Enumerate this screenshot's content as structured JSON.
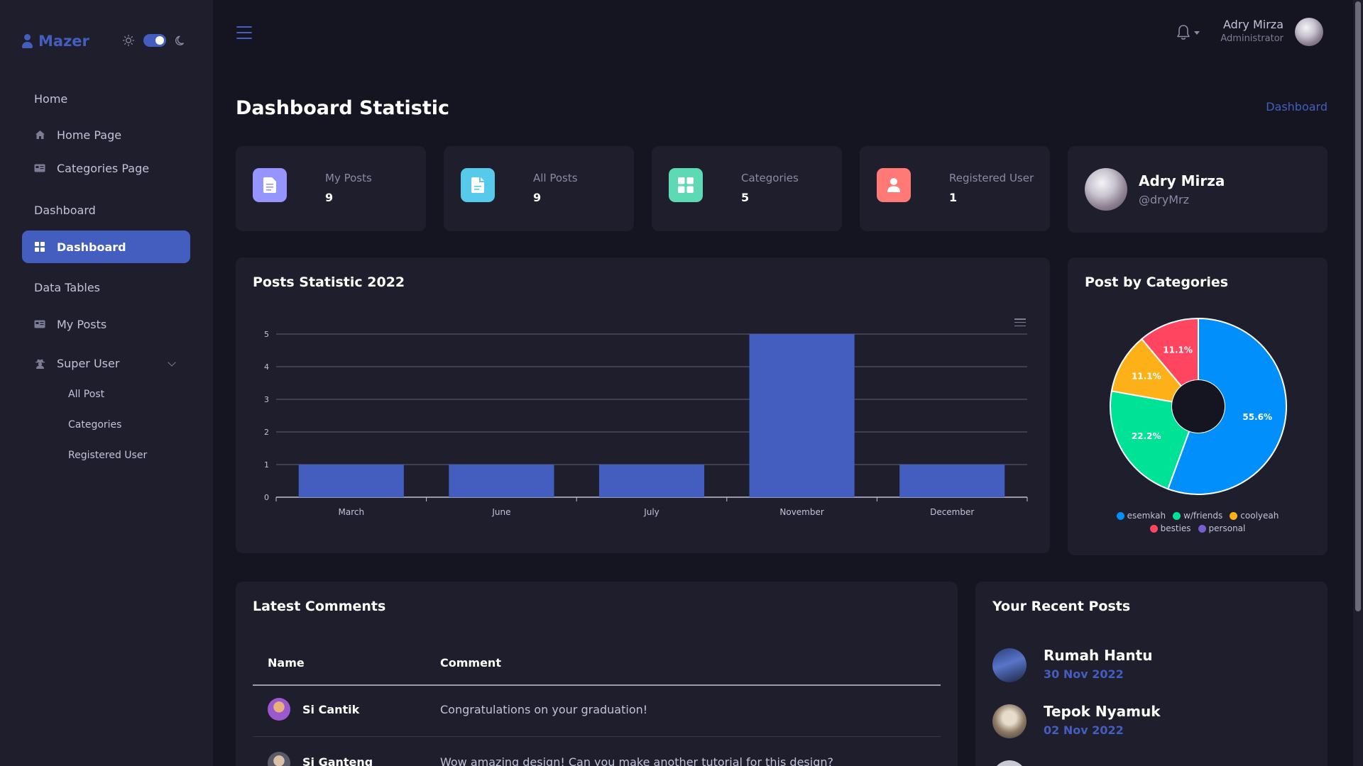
{
  "brand": {
    "name": "Mazer"
  },
  "sidebar": {
    "sections": [
      {
        "title": "Home",
        "items": [
          {
            "label": "Home Page",
            "icon": "house-icon"
          },
          {
            "label": "Categories Page",
            "icon": "card-icon"
          }
        ]
      },
      {
        "title": "Dashboard",
        "items": [
          {
            "label": "Dashboard",
            "icon": "grid-icon",
            "active": true
          }
        ]
      },
      {
        "title": "Data Tables",
        "items": [
          {
            "label": "My Posts",
            "icon": "card-icon"
          },
          {
            "label": "Super User",
            "icon": "user-secret-icon",
            "expanded": true
          }
        ]
      }
    ],
    "super_user_sub": [
      "All Post",
      "Categories",
      "Registered User"
    ]
  },
  "header": {
    "user": {
      "name": "Adry Mirza",
      "role": "Administrator"
    }
  },
  "page": {
    "title": "Dashboard Statistic",
    "breadcrumb": "Dashboard"
  },
  "stats": [
    {
      "label": "My Posts",
      "value": "9",
      "color": "#9694ff"
    },
    {
      "label": "All Posts",
      "value": "9",
      "color": "#57caeb"
    },
    {
      "label": "Categories",
      "value": "5",
      "color": "#5ddab4"
    },
    {
      "label": "Registered User",
      "value": "1",
      "color": "#ff7976"
    }
  ],
  "profile": {
    "name": "Adry Mirza",
    "handle": "@dryMrz"
  },
  "posts_chart_title": "Posts Statistic 2022",
  "categories_chart_title": "Post by Categories",
  "chart_data": [
    {
      "type": "bar",
      "title": "Posts Statistic 2022",
      "categories": [
        "March",
        "June",
        "July",
        "November",
        "December"
      ],
      "values": [
        1,
        1,
        1,
        5,
        1
      ],
      "ylim": [
        0,
        5
      ],
      "yticks": [
        "0",
        "1",
        "2",
        "3",
        "4",
        "5"
      ],
      "color": "#435ebe",
      "grid": true
    },
    {
      "type": "pie",
      "title": "Post by Categories",
      "donut": true,
      "slices": [
        {
          "name": "esemkah",
          "value": 55.6,
          "label": "55.6%",
          "color": "#008ffb"
        },
        {
          "name": "w/friends",
          "value": 22.2,
          "label": "22.2%",
          "color": "#00e396"
        },
        {
          "name": "coolyeah",
          "value": 11.1,
          "label": "11.1%",
          "color": "#feb019"
        },
        {
          "name": "besties",
          "value": 11.1,
          "label": "11.1%",
          "color": "#ff4560"
        },
        {
          "name": "personal",
          "value": 0,
          "label": "",
          "color": "#775dd0"
        }
      ],
      "legend": "bottom"
    }
  ],
  "comments": {
    "title": "Latest Comments",
    "columns": [
      "Name",
      "Comment"
    ],
    "rows": [
      {
        "name": "Si Cantik",
        "comment": "Congratulations on your graduation!"
      },
      {
        "name": "Si Ganteng",
        "comment": "Wow amazing design! Can you make another tutorial for this design?"
      }
    ]
  },
  "recent_posts": {
    "title": "Your Recent Posts",
    "items": [
      {
        "title": "Rumah Hantu",
        "date": "30 Nov 2022"
      },
      {
        "title": "Tepok Nyamuk",
        "date": "02 Nov 2022"
      }
    ]
  }
}
